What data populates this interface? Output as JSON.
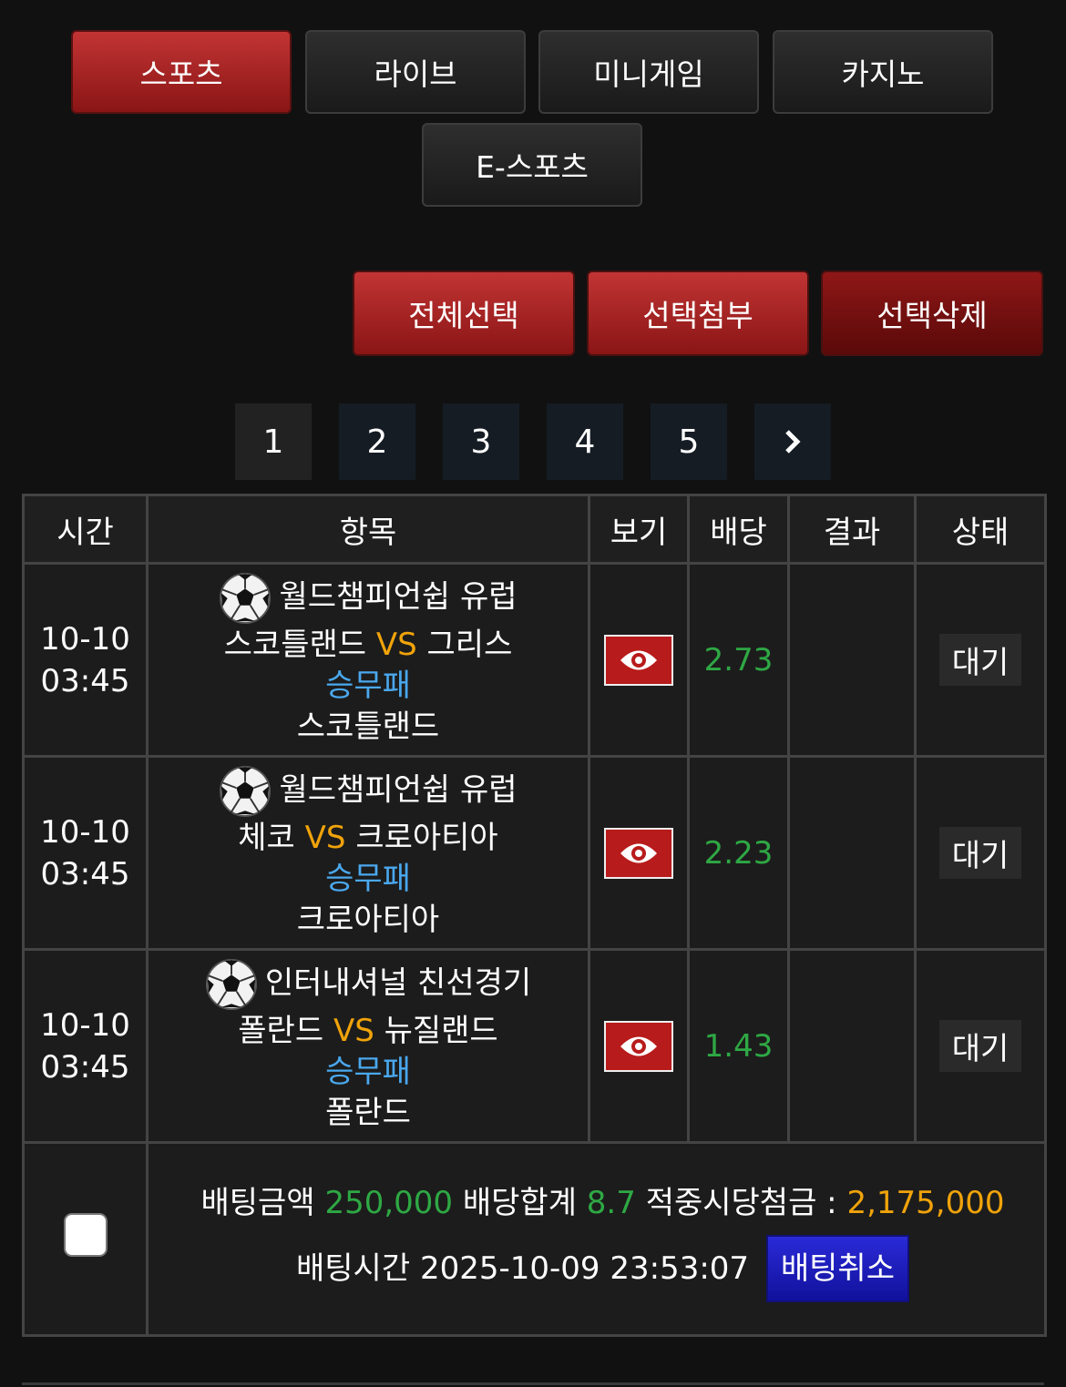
{
  "tabs": [
    {
      "label": "스포츠",
      "active": true
    },
    {
      "label": "라이브",
      "active": false
    },
    {
      "label": "미니게임",
      "active": false
    },
    {
      "label": "카지노",
      "active": false
    },
    {
      "label": "E-스포츠",
      "active": false
    }
  ],
  "actions": {
    "select_all": "전체선택",
    "attach": "선택첨부",
    "delete": "선택삭제"
  },
  "pagination": {
    "pages": [
      "1",
      "2",
      "3",
      "4",
      "5"
    ],
    "current": "1",
    "next_icon": "chevron-right-icon"
  },
  "table": {
    "headers": {
      "time": "시간",
      "item": "항목",
      "view": "보기",
      "odds": "배당",
      "result": "결과",
      "status": "상태"
    },
    "rows": [
      {
        "date": "10-10",
        "time": "03:45",
        "league": "월드챔피언쉽 유럽",
        "home": "스코틀랜드",
        "vs": "VS",
        "away": "그리스",
        "market": "승무패",
        "pick": "스코틀랜드",
        "odds": "2.73",
        "result": "",
        "status": "대기"
      },
      {
        "date": "10-10",
        "time": "03:45",
        "league": "월드챔피언쉽 유럽",
        "home": "체코",
        "vs": "VS",
        "away": "크로아티아",
        "market": "승무패",
        "pick": "크로아티아",
        "odds": "2.23",
        "result": "",
        "status": "대기"
      },
      {
        "date": "10-10",
        "time": "03:45",
        "league": "인터내셔널 친선경기",
        "home": "폴란드",
        "vs": "VS",
        "away": "뉴질랜드",
        "market": "승무패",
        "pick": "폴란드",
        "odds": "1.43",
        "result": "",
        "status": "대기"
      }
    ]
  },
  "summary": {
    "bet_amount_label": "배팅금액",
    "bet_amount": "250,000",
    "odds_total_label": "배당합계",
    "odds_total": "8.7",
    "win_amount_label": "적중시당첨금 :",
    "win_amount": "2,175,000",
    "bet_time_label": "배팅시간",
    "bet_time": "2025-10-09 23:53:07",
    "cancel_label": "배팅취소"
  },
  "colors": {
    "accent_red": "#b81b1b",
    "odds_green": "#2ea844",
    "vs_orange": "#f0a30a",
    "market_blue": "#4aa8ee",
    "cancel_blue": "#1a1ac0"
  }
}
